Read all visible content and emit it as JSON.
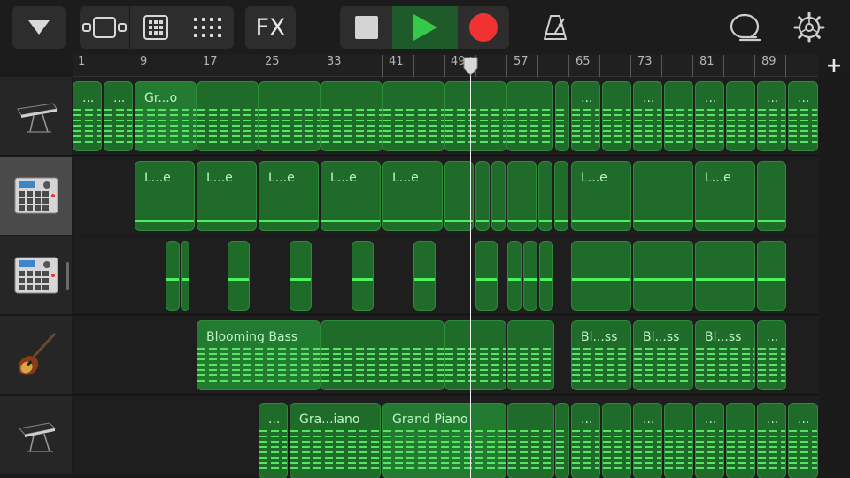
{
  "toolbar": {
    "fx_label": "FX"
  },
  "ruler": {
    "bars": [
      "1",
      "9",
      "17",
      "25",
      "33",
      "41",
      "49",
      "57",
      "65",
      "73",
      "81",
      "89"
    ],
    "add_track": "+"
  },
  "tracks": [
    {
      "instrument_icon": "keyboard-icon",
      "regions": [
        {
          "label": "..."
        },
        {
          "label": "..."
        },
        {
          "label": "Gr...o"
        }
      ],
      "more_labels": [
        "...",
        "...",
        "...",
        "...",
        "..."
      ]
    },
    {
      "instrument_icon": "drum-machine-icon",
      "regions_labels": [
        "L...e",
        "L...e",
        "L...e",
        "L...e",
        "L...e",
        "L...e",
        "L...e"
      ]
    },
    {
      "instrument_icon": "drum-machine-icon"
    },
    {
      "instrument_icon": "bass-guitar-icon",
      "labels": [
        "Blooming Bass",
        "Bl...ss",
        "Bl...ss",
        "Bl...ss",
        "..."
      ]
    },
    {
      "instrument_icon": "grand-piano-icon",
      "labels": [
        "...",
        "Gra...iano",
        "Grand Piano",
        "...",
        "...",
        "...",
        "...",
        "...",
        "..."
      ]
    }
  ],
  "colors": {
    "region_fill": "#1e6b2a",
    "note_green": "#5ef06a",
    "play_green": "#35c94a",
    "record_red": "#f23232"
  }
}
